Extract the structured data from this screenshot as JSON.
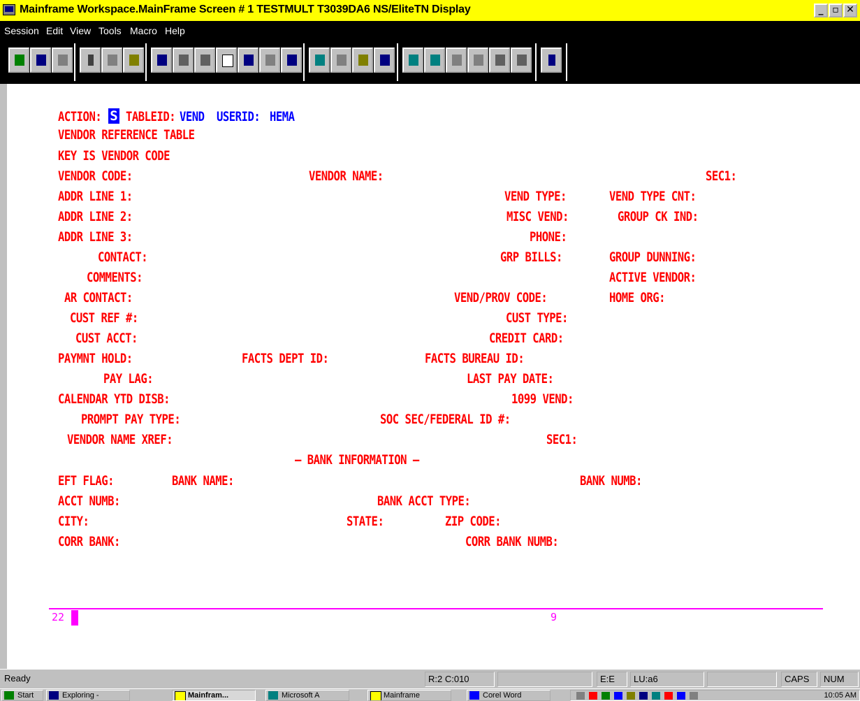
{
  "window": {
    "title": "Mainframe Workspace.MainFrame Screen # 1   TESTMULT   T3039DA6   NS/EliteTN Display",
    "buttons": {
      "minimize": "_",
      "restore": "▫",
      "close": "✕"
    }
  },
  "menu": [
    "Session",
    "Edit",
    "View",
    "Tools",
    "Macro",
    "Help"
  ],
  "screen": {
    "line1": {
      "action_label": "ACTION:",
      "action_value": "S",
      "tableid_label": "TABLEID:",
      "tableid_value": "VEND",
      "userid_label": "USERID:",
      "userid_value": "HEMA"
    },
    "table_title": "VENDOR REFERENCE TABLE",
    "key_line": "KEY IS VENDOR CODE",
    "fields": {
      "vendor_code": "VENDOR CODE:",
      "vendor_name": "VENDOR NAME:",
      "sec1_top": "SEC1:",
      "addr1": "ADDR LINE 1:",
      "vend_type": "VEND TYPE:",
      "vend_type_cnt": "VEND TYPE CNT:",
      "addr2": "ADDR LINE 2:",
      "misc_vend": "MISC VEND:",
      "group_ck_ind": "GROUP CK IND:",
      "addr3": "ADDR LINE 3:",
      "phone": "PHONE:",
      "contact": "CONTACT:",
      "grp_bills": "GRP BILLS:",
      "group_dunning": "GROUP DUNNING:",
      "comments": "COMMENTS:",
      "active_vendor": "ACTIVE VENDOR:",
      "ar_contact": "AR CONTACT:",
      "vend_prov_code": "VEND/PROV CODE:",
      "home_org": "HOME ORG:",
      "cust_ref": "CUST REF #:",
      "cust_type": "CUST TYPE:",
      "cust_acct": "CUST ACCT:",
      "credit_card": "CREDIT CARD:",
      "paymnt_hold": "PAYMNT HOLD:",
      "facts_dept_id": "FACTS DEPT ID:",
      "facts_bureau_id": "FACTS BUREAU ID:",
      "pay_lag": "PAY LAG:",
      "last_pay_date": "LAST PAY DATE:",
      "calendar_ytd": "CALENDAR YTD DISB:",
      "vend_1099": "1099 VEND:",
      "prompt_pay_type": "PROMPT PAY TYPE:",
      "soc_sec": "SOC SEC/FEDERAL ID #:",
      "vendor_name_xref": "VENDOR NAME XREF:",
      "sec1_bottom": "SEC1:",
      "bank_info": "— BANK INFORMATION —",
      "eft_flag": "EFT FLAG:",
      "bank_name": "BANK NAME:",
      "bank_numb": "BANK NUMB:",
      "acct_numb": "ACCT NUMB:",
      "bank_acct_type": "BANK ACCT TYPE:",
      "city": "CITY:",
      "state": "STATE:",
      "zip_code": "ZIP CODE:",
      "corr_bank": "CORR BANK:",
      "corr_bank_numb": "CORR BANK NUMB:"
    },
    "command_line": {
      "left": "22",
      "right": "9"
    }
  },
  "status": {
    "ready": "Ready",
    "position": "R:2 C:010",
    "session": "E:E",
    "lu": "LU:a6",
    "caps": "CAPS",
    "num": "NUM"
  },
  "taskbar": {
    "start": "Start",
    "tasks": [
      "Exploring -",
      "Mainfram...",
      "Microsoft A",
      "Mainframe",
      "Corel Word"
    ],
    "clock": "10:05 AM"
  },
  "colors": {
    "field_label": "#ff0000",
    "field_value": "#0000ff",
    "command_line": "#ff00ff",
    "title_bar": "#ffff00"
  }
}
